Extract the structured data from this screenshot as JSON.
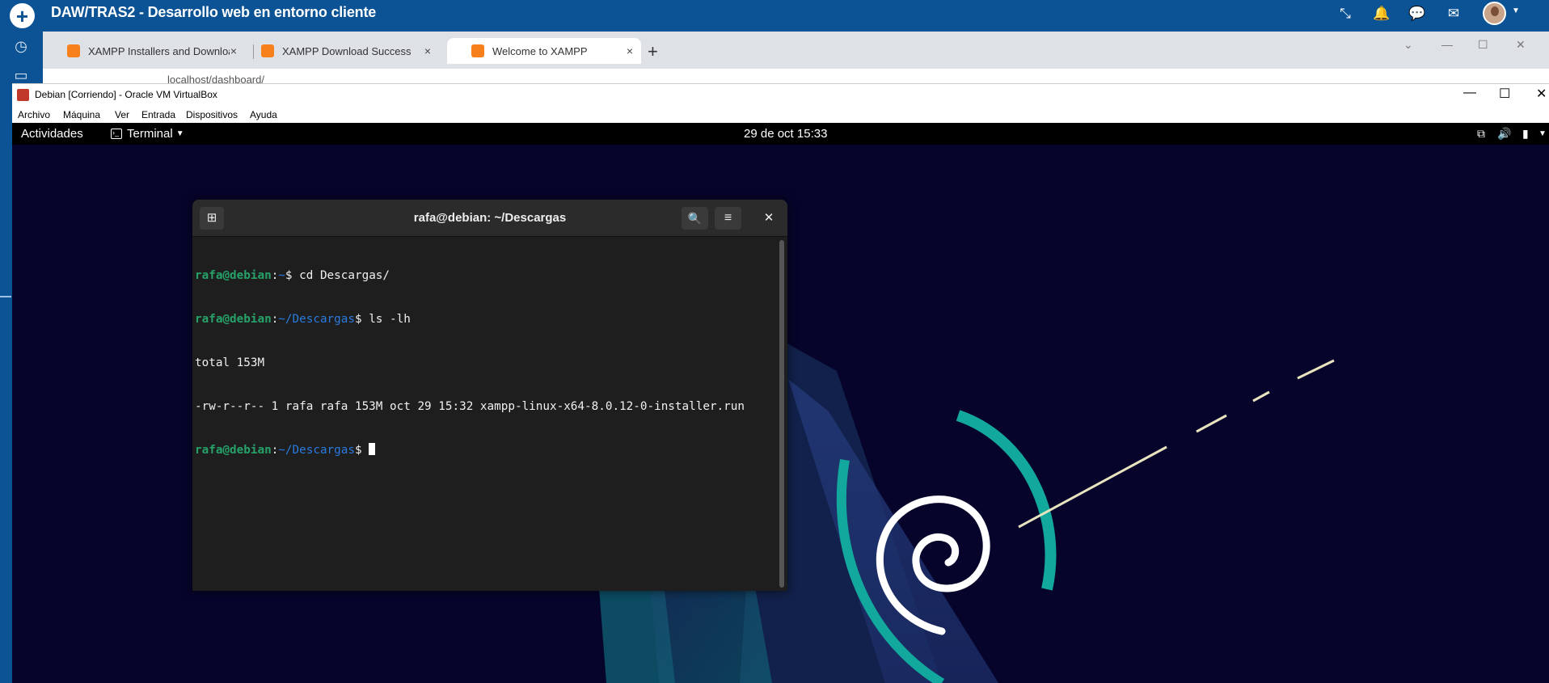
{
  "lms": {
    "title": "DAW/TRAS2 - Desarrollo web en entorno cliente",
    "plus_label": "+",
    "icons": [
      "shrink-icon",
      "bell-icon",
      "chat-icon",
      "mail-icon"
    ]
  },
  "chrome": {
    "tabs": [
      {
        "label": "XAMPP Installers and Downloads",
        "close": "×"
      },
      {
        "label": "XAMPP Download Success",
        "close": "×"
      },
      {
        "label": "Welcome to XAMPP",
        "close": "×"
      }
    ],
    "new_tab": "+",
    "url": "localhost/dashboard/"
  },
  "vbox": {
    "title": "Debian [Corriendo] - Oracle VM VirtualBox",
    "menu": [
      "Archivo",
      "Máquina",
      "Ver",
      "Entrada",
      "Dispositivos",
      "Ayuda"
    ]
  },
  "gnome": {
    "activities": "Actividades",
    "app_name": "Terminal",
    "clock": "29 de oct  15:33"
  },
  "terminal": {
    "title": "rafa@debian: ~/Descargas",
    "prompt_user": "rafa@debian",
    "lines": [
      {
        "path": "~",
        "cmd": "cd Descargas/"
      },
      {
        "path": "~/Descargas",
        "cmd": "ls -lh"
      },
      {
        "output": "total 153M"
      },
      {
        "output": "-rw-r--r-- 1 rafa rafa 153M oct 29 15:32 xampp-linux-x64-8.0.12-0-installer.run"
      },
      {
        "path": "~/Descargas",
        "cmd": ""
      }
    ]
  },
  "colors": {
    "lms_blue": "#0b5394",
    "prompt_green": "#26a269",
    "path_blue": "#2a7bde",
    "debian_teal": "#12a89d"
  }
}
